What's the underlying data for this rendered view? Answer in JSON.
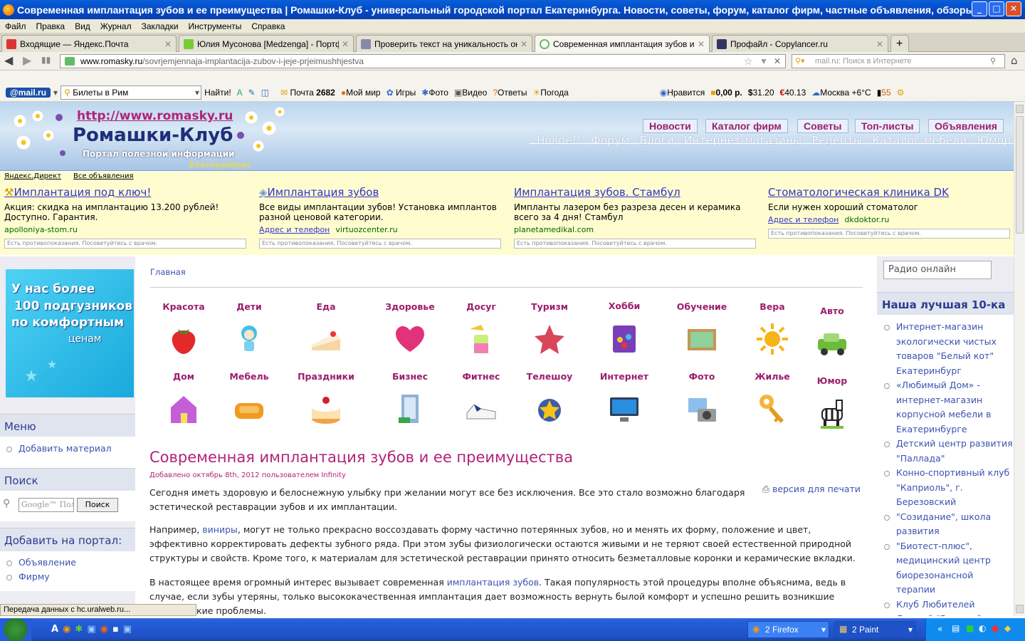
{
  "window": {
    "title": "Современная имплантация зубов и ее преимущества | Ромашки-Клуб - универсальный городской портал Екатеринбурга. Новости, советы, форум, каталог фирм, частные объявления, обзоры. - Mozilla Fir...",
    "min": "_",
    "max": "□",
    "close": "✕"
  },
  "menu": [
    "Файл",
    "Правка",
    "Вид",
    "Журнал",
    "Закладки",
    "Инструменты",
    "Справка"
  ],
  "tabs": [
    {
      "label": "Входящие — Яндекс.Почта",
      "color": "#d33"
    },
    {
      "label": "Юлия Мусонова [Medzenga] - Портфолио",
      "color": "#7c3"
    },
    {
      "label": "Проверить текст на уникальность онл...",
      "color": "#88a"
    },
    {
      "label": "Современная имплантация зубов и ее ...",
      "color": "#6b6"
    },
    {
      "label": "Профайл - Copylancer.ru",
      "color": "#336"
    }
  ],
  "tab_new": "+",
  "nav": {
    "url_domain": "www.romasky.ru",
    "url_path": "/sovrjemjennaja-implantacija-zubov-i-jeje-prjeimushhjestva",
    "search_placeholder": "mail.ru: Поиск в Интернете"
  },
  "mailbar": {
    "logo": "@mail.ru",
    "search_value": "Билеты в Рим",
    "find": "Найти!",
    "mail": "Почта",
    "mail_count": "2682",
    "myworld": "Мой мир",
    "games": "Игры",
    "photo": "Фото",
    "video": "Видео",
    "answers": "Ответы",
    "weather": "Погода",
    "like": "Нравится",
    "money": "0,00 р.",
    "usd": "31.20",
    "eur": "40.13",
    "city": "Москва +6°С",
    "traffic": "55"
  },
  "header": {
    "url": "http://www.romasky.ru",
    "name": "Ромашки-Клуб",
    "tagline": "Портал полезной информации",
    "city": "Екатеринбург",
    "nav_top": [
      "Новости",
      "Каталог фирм",
      "Советы",
      "Топ-листы",
      "Объявления"
    ],
    "nav_sub": [
      "Новое!!",
      "Форум",
      "Блоги",
      "Интернет-магазины",
      "Рецепты",
      "Каталог мебели",
      "Юмор"
    ]
  },
  "ads": {
    "direct": "Яндекс.Директ",
    "all": "Все объявления",
    "items": [
      {
        "title": "Имплантация под ключ!",
        "text": "Акция: скидка на имплантацию 13.200 рублей! Доступно. Гарантия.",
        "addr": "",
        "url": "apolloniya-stom.ru",
        "warn": "Есть противопоказания. Посоветуйтесь с врачом."
      },
      {
        "title": "Имплантация зубов",
        "text": "Все виды имплантации зубов! Установка имплантов разной ценовой категории.",
        "addr": "Адрес и телефон",
        "url": "virtuozcenter.ru",
        "warn": "Есть противопоказания. Посоветуйтесь с врачом."
      },
      {
        "title": "Имплантация зубов. Стамбул",
        "text": "Импланты лазером без разреза десен и керамика всего за 4 дня! Стамбул",
        "addr": "",
        "url": "planetamedikal.com",
        "warn": "Есть противопоказания. Посоветуйтесь с врачом."
      },
      {
        "title": "Стоматологическая клиника DK",
        "text": "Если нужен хороший стоматолог",
        "addr": "Адрес и телефон",
        "url": "dkdoktor.ru",
        "warn": "Есть противопоказания. Посоветуйтесь с врачом."
      }
    ]
  },
  "left": {
    "banner": [
      "У нас более",
      "100 подгузников",
      "по комфортным",
      "ценам"
    ],
    "menu_title": "Меню",
    "menu_items": [
      "Добавить материал"
    ],
    "search_title": "Поиск",
    "search_placeholder": "Google™ Пользо",
    "search_btn": "Поиск",
    "add_title": "Добавить на портал:",
    "add_items": [
      "Объявление",
      "Фирму"
    ]
  },
  "breadcrumb": "Главная",
  "categories_row1": [
    {
      "label": "Красота",
      "icon": "strawberry-icon"
    },
    {
      "label": "Дети",
      "icon": "doll-icon"
    },
    {
      "label": "Еда",
      "icon": "cake-slice-icon"
    },
    {
      "label": "Здоровье",
      "icon": "heart-icon"
    },
    {
      "label": "Досуг",
      "icon": "cocktail-icon"
    },
    {
      "label": "Туризм",
      "icon": "starfish-icon"
    },
    {
      "label": "Хобби",
      "icon": "candy-bag-icon"
    },
    {
      "label": "Обучение",
      "icon": "chalkboard-icon"
    },
    {
      "label": "Вера",
      "icon": "sun-icon"
    },
    {
      "label": "Авто",
      "icon": "car-icon"
    }
  ],
  "categories_row2": [
    {
      "label": "Дом",
      "icon": "house-icon"
    },
    {
      "label": "Мебель",
      "icon": "sofa-icon"
    },
    {
      "label": "Праздники",
      "icon": "birthday-cake-icon"
    },
    {
      "label": "Бизнес",
      "icon": "office-building-icon"
    },
    {
      "label": "Фитнес",
      "icon": "sneaker-icon"
    },
    {
      "label": "Телешоу",
      "icon": "film-star-icon"
    },
    {
      "label": "Интернет",
      "icon": "monitor-icon"
    },
    {
      "label": "Фото",
      "icon": "camera-icon"
    },
    {
      "label": "Жилье",
      "icon": "key-icon"
    },
    {
      "label": "Юмор",
      "icon": "zebra-icon"
    }
  ],
  "article": {
    "title": "Современная имплантация зубов и ее преимущества",
    "meta": "Добавлено октябрь 8th, 2012 пользователем Infinity",
    "print": "версия для печати",
    "p1": "Сегодня иметь здоровую и белоснежную улыбку при желании могут все без исключения. Все это стало возможно благодаря эстетической реставрации зубов и их имплантации.",
    "p2_a": "Например, ",
    "p2_link": "виниры",
    "p2_b": ", могут не только прекрасно воссоздавать форму частично потерянных зубов, но и менять их форму, положение и цвет, эффективно корректировать дефекты зубного ряда. При этом зубы физиологически остаются живыми и не теряют своей естественной природной структуры и свойств. Кроме того, к материалам для эстетической реставрации принято относить безметалловые коронки и керамические вкладки.",
    "p3_a": "В настоящее время огромный интерес вызывает современная ",
    "p3_link": "имплантация зубов",
    "p3_b": ". Такая популярность этой процедуры вполне объяснима, ведь в случае, если зубы утеряны, только высококачественная имплантация дает возможность вернуть былой комфорт и успешно решить возникшие эстетические проблемы."
  },
  "right": {
    "radio": "Радио онлайн",
    "title": "Наша лучшая 10-ка",
    "items": [
      "Интернет-магазин экологически чистых товаров \"Белый кот\" Екатеринбург",
      "«Любимый Дом» - интернет-магазин корпусной мебели в Екатеринбурге",
      "Детский центр развития \"Паллада\"",
      "Конно-спортивный клуб \"Каприоль\", г. Березовский",
      "\"Созидание\", школа развития",
      "\"Биотест-плюс\", медицинский центр биорезонансной терапии",
      "Клуб Любителей Ложной \"Валиный"
    ]
  },
  "status": "Передача данных с hc.uralweb.ru...",
  "taskbar": {
    "firefox": "2 Firefox",
    "paint": "2 Paint"
  }
}
